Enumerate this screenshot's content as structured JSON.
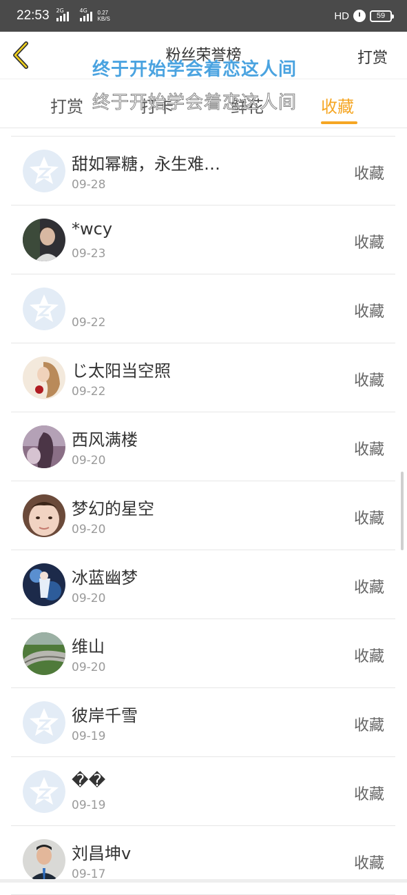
{
  "statusbar": {
    "time": "22:53",
    "sig1": "2G",
    "sig2": "4G",
    "speed": "0.27\nKB/S",
    "hd": "HD",
    "battery": "59"
  },
  "header": {
    "title": "粉丝荣誉榜",
    "action": "打赏"
  },
  "overlay": {
    "line1": "终于开始学会着恋这人间",
    "line2": "终于开始学会着恋这人间"
  },
  "tabs": [
    {
      "label": "打赏"
    },
    {
      "label": "打卡"
    },
    {
      "label": "鲜花"
    },
    {
      "label": "收藏"
    }
  ],
  "active_tab": "收藏",
  "colors": {
    "accent": "#f5a623",
    "overlay": "#4aa3e0"
  },
  "items": [
    {
      "name": "甜如幂糖，永生难…",
      "date": "09-28",
      "action": "收藏",
      "avatar": "default-avatar-icon"
    },
    {
      "name": "*wcy",
      "date": "09-23",
      "action": "收藏",
      "avatar": "photo-avatar"
    },
    {
      "name": "",
      "date": "09-22",
      "action": "收藏",
      "avatar": "default-avatar-icon"
    },
    {
      "name": "じ太阳当空照",
      "date": "09-22",
      "action": "收藏",
      "avatar": "photo-avatar"
    },
    {
      "name": "西风满楼",
      "date": "09-20",
      "action": "收藏",
      "avatar": "photo-avatar"
    },
    {
      "name": "梦幻的星空",
      "date": "09-20",
      "action": "收藏",
      "avatar": "photo-avatar"
    },
    {
      "name": "冰蓝幽梦",
      "date": "09-20",
      "action": "收藏",
      "avatar": "photo-avatar"
    },
    {
      "name": "维山",
      "date": "09-20",
      "action": "收藏",
      "avatar": "photo-avatar"
    },
    {
      "name": "彼岸千雪",
      "date": "09-19",
      "action": "收藏",
      "avatar": "default-avatar-icon"
    },
    {
      "name": "��",
      "date": "09-19",
      "action": "收藏",
      "avatar": "default-avatar-icon"
    },
    {
      "name": "刘昌坤v",
      "date": "09-17",
      "action": "收藏",
      "avatar": "photo-avatar"
    }
  ]
}
